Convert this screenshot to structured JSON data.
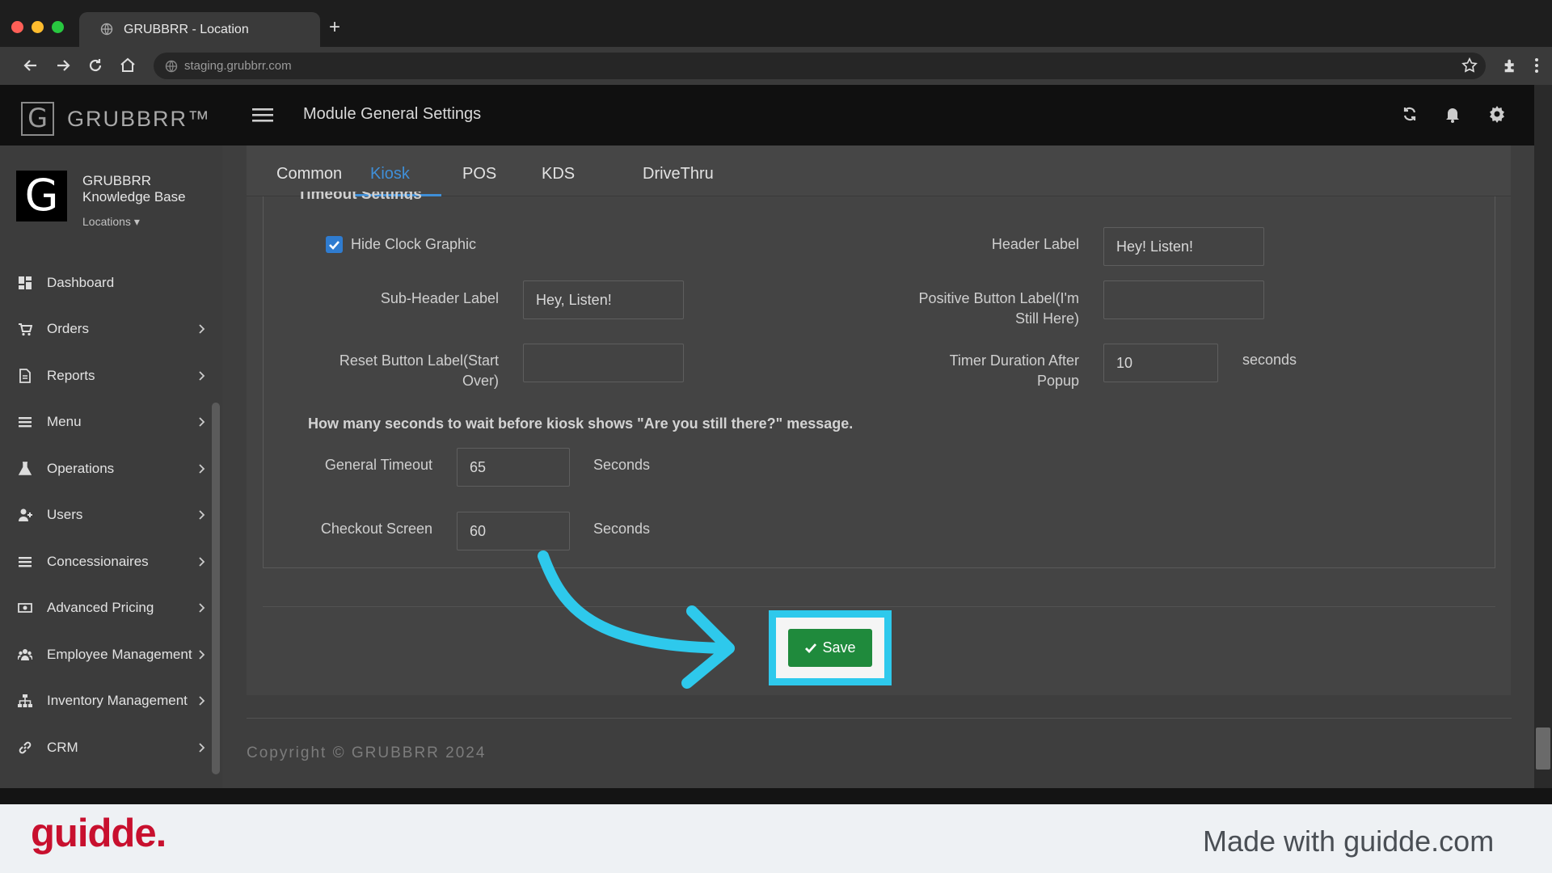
{
  "browser": {
    "tab_title": "GRUBBRR - Location",
    "new_tab": "+",
    "url": "staging.grubbrr.com"
  },
  "app": {
    "logo_letter": "G",
    "logo_text": "GRUBBRR™",
    "page_title": "Module General Settings"
  },
  "org": {
    "logo_letter": "G",
    "name": "GRUBBRR Knowledge Base",
    "locations_label": "Locations ▾"
  },
  "sidebar": {
    "items": [
      {
        "label": "Dashboard",
        "icon": "dashboard-icon",
        "chevron": false
      },
      {
        "label": "Orders",
        "icon": "cart-icon",
        "chevron": true
      },
      {
        "label": "Reports",
        "icon": "document-icon",
        "chevron": true
      },
      {
        "label": "Menu",
        "icon": "list-icon",
        "chevron": true
      },
      {
        "label": "Operations",
        "icon": "flask-icon",
        "chevron": true
      },
      {
        "label": "Users",
        "icon": "add-user-icon",
        "chevron": true
      },
      {
        "label": "Concessionaires",
        "icon": "list-icon",
        "chevron": true
      },
      {
        "label": "Advanced Pricing",
        "icon": "money-icon",
        "chevron": true
      },
      {
        "label": "Employee Management",
        "icon": "users-icon",
        "chevron": true
      },
      {
        "label": "Inventory Management",
        "icon": "sitemap-icon",
        "chevron": true
      },
      {
        "label": "CRM",
        "icon": "link-icon",
        "chevron": true
      }
    ]
  },
  "tabs": [
    "Common",
    "Kiosk",
    "POS",
    "KDS",
    "DriveThru"
  ],
  "active_tab": "Kiosk",
  "section": {
    "title": "Timeout Settings"
  },
  "form": {
    "hide_clock": {
      "label": "Hide Clock Graphic",
      "checked": true
    },
    "header_label": {
      "label": "Header Label",
      "value": "Hey! Listen!"
    },
    "sub_header_label": {
      "label": "Sub-Header Label",
      "value": "Hey, Listen!"
    },
    "positive_button_label": {
      "label_line1": "Positive Button Label(I'm",
      "label_line2": "Still Here)",
      "value": ""
    },
    "reset_button_label": {
      "label_line1": "Reset Button Label(Start",
      "label_line2": "Over)",
      "value": ""
    },
    "timer_duration": {
      "label_line1": "Timer Duration After",
      "label_line2": "Popup",
      "value": "10",
      "unit": "seconds"
    },
    "note": "How many seconds to wait before kiosk shows \"Are you still there?\" message.",
    "general_timeout": {
      "label": "General Timeout",
      "value": "65",
      "unit": "Seconds"
    },
    "checkout_screen": {
      "label": "Checkout Screen",
      "value": "60",
      "unit": "Seconds"
    }
  },
  "save_button": {
    "label": "Save",
    "icon": "check-icon"
  },
  "footer": {
    "copyright": "Copyright © GRUBBRR 2024"
  },
  "branding": {
    "logo": "guidde.",
    "made_with": "Made with guidde.com"
  },
  "colors": {
    "accent_tab": "#3f8fd8",
    "save_green": "#1f8a3c",
    "highlight": "#2ec9ec",
    "guidde_red": "#c8102e"
  }
}
